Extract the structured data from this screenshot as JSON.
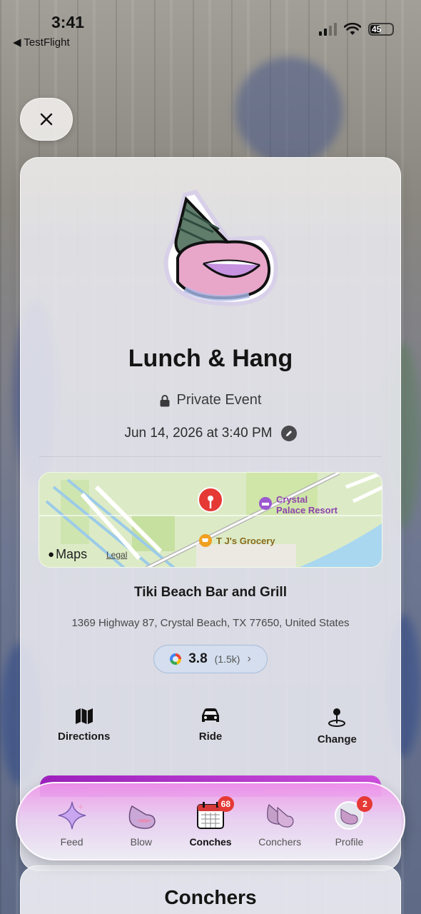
{
  "status_bar": {
    "time": "3:41",
    "back_label": "◀ TestFlight",
    "battery": "45"
  },
  "event": {
    "title": "Lunch & Hang",
    "privacy": "Private Event",
    "datetime": "Jun 14, 2026 at 3:40 PM"
  },
  "map": {
    "provider": "Maps",
    "legal": "Legal",
    "poi_1": "Crystal",
    "poi_1b": "Palace Resort",
    "poi_2": "T J's Grocery"
  },
  "venue": {
    "name": "Tiki Beach Bar and Grill",
    "address": "1369 Highway 87, Crystal Beach, TX 77650, United States",
    "rating": "3.8",
    "rating_count": "(1.5k)"
  },
  "actions": [
    {
      "label": "Directions",
      "icon": "map-icon"
    },
    {
      "label": "Ride",
      "icon": "car-icon"
    },
    {
      "label": "Change",
      "icon": "pin-icon"
    }
  ],
  "tabs": [
    {
      "label": "Feed",
      "icon": "sparkle-icon"
    },
    {
      "label": "Blow",
      "icon": "shell-icon"
    },
    {
      "label": "Conches",
      "icon": "calendar-icon",
      "badge": "68"
    },
    {
      "label": "Conchers",
      "icon": "conchers-icon"
    },
    {
      "label": "Profile",
      "icon": "avatar-icon",
      "badge": "2"
    }
  ],
  "active_tab": "Conches",
  "conchers_section": {
    "title": "Conchers"
  },
  "colors": {
    "tab_active_gradient": "#f096eb",
    "badge": "#e53935",
    "pin": "#e53935"
  }
}
